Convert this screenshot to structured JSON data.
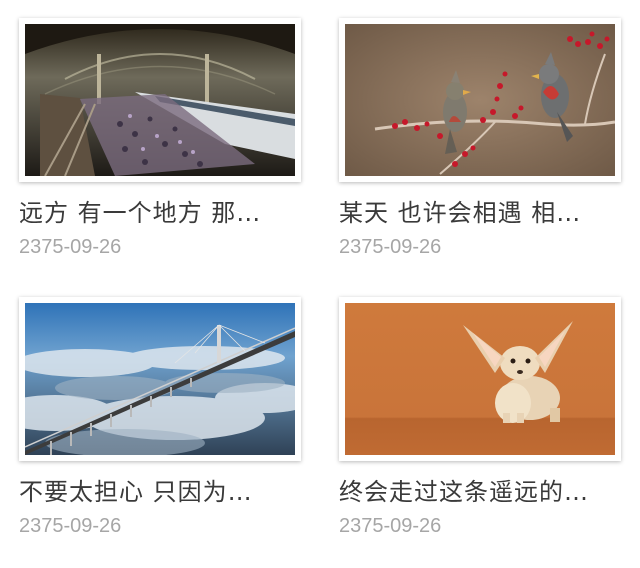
{
  "cards": [
    {
      "title": "远方 有一个地方 那…",
      "date": "2375-09-26",
      "image": "train-station-photo"
    },
    {
      "title": "某天 也许会相遇 相…",
      "date": "2375-09-26",
      "image": "birds-on-branch-photo"
    },
    {
      "title": "不要太担心 只因为…",
      "date": "2375-09-26",
      "image": "bridge-over-clouds-photo"
    },
    {
      "title": "终会走过这条遥远的…",
      "date": "2375-09-26",
      "image": "fennec-fox-photo"
    }
  ]
}
